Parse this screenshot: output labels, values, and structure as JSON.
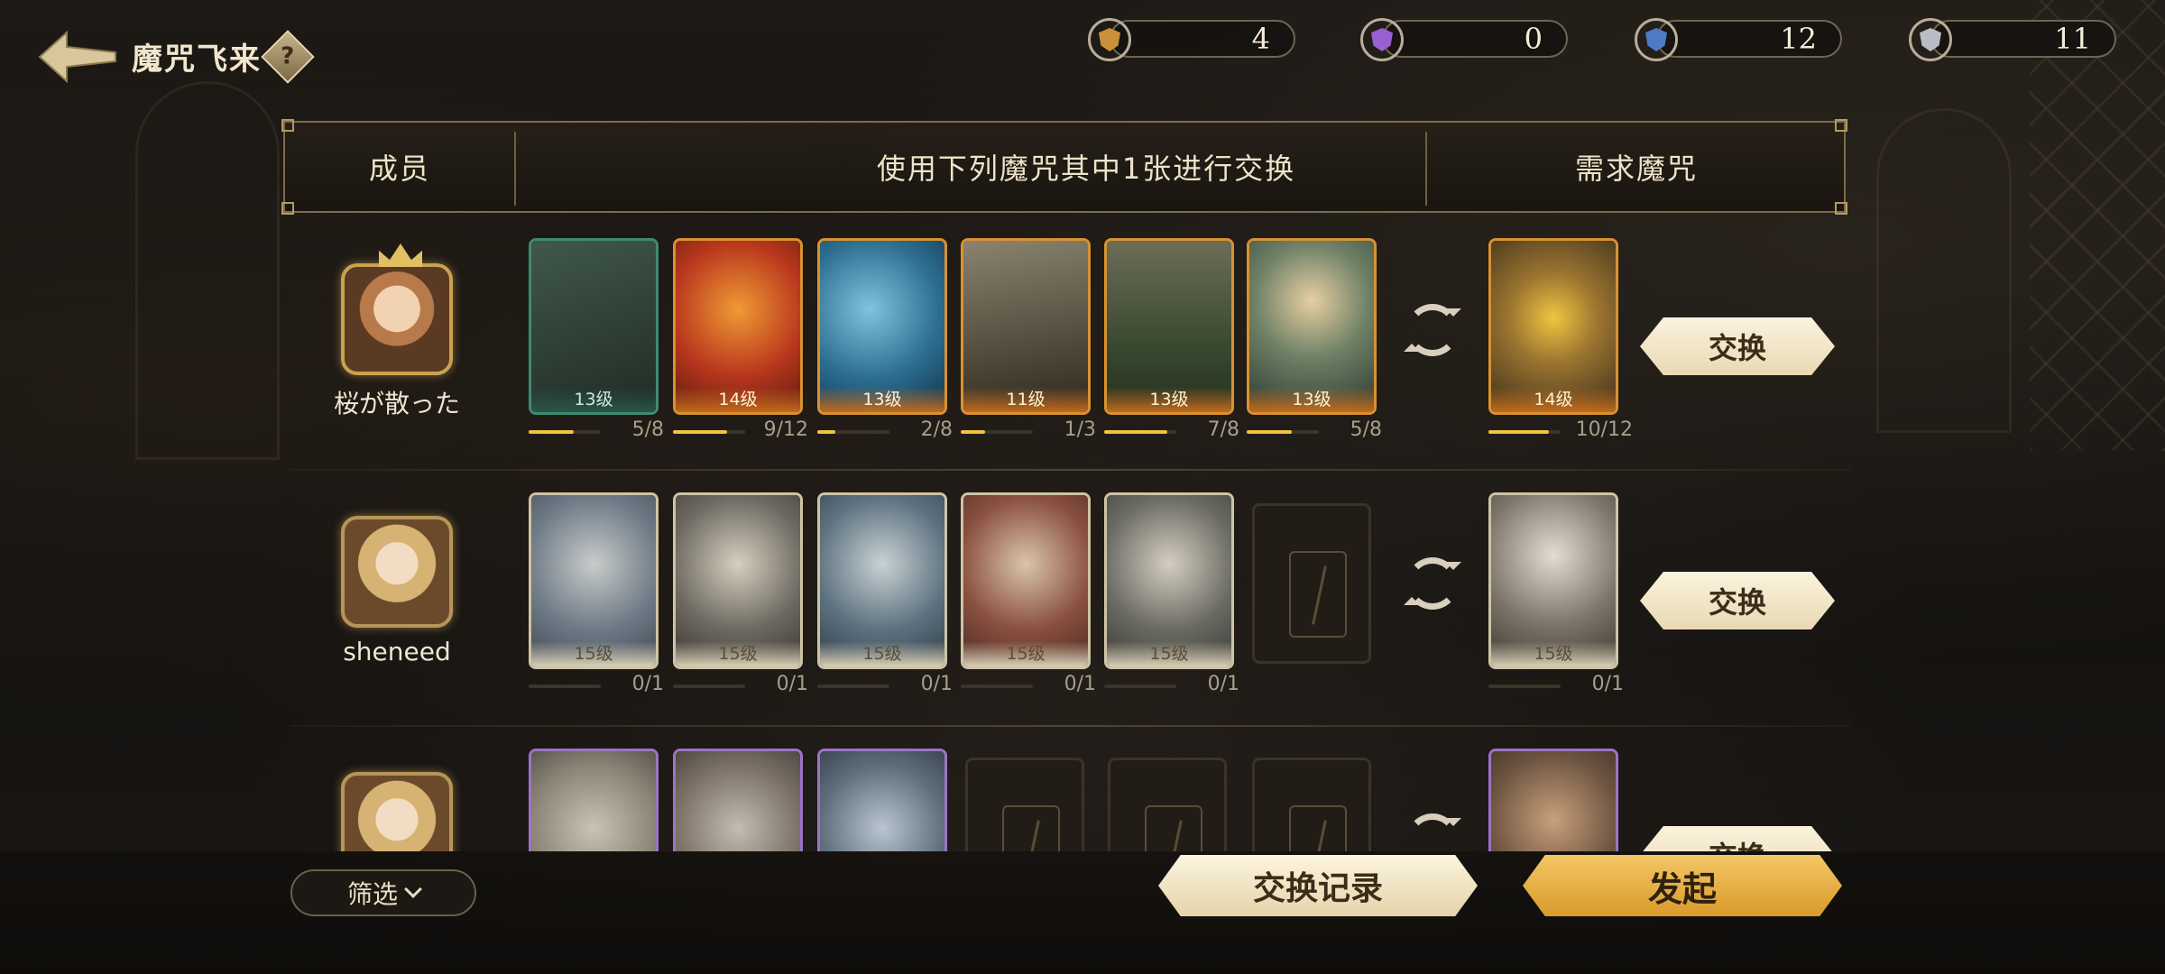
{
  "header": {
    "title": "魔咒飞来",
    "help_label": "?",
    "currencies": [
      {
        "name": "gold-badge",
        "color": "#c9923a",
        "value": "4"
      },
      {
        "name": "purple-badge",
        "color": "#9a5fd1",
        "value": "0"
      },
      {
        "name": "blue-badge",
        "color": "#4f79c7",
        "value": "12"
      },
      {
        "name": "silver-badge",
        "color": "#b8bcc4",
        "value": "11"
      }
    ]
  },
  "table": {
    "col_member": "成员",
    "col_offer": "使用下列魔咒其中1张进行交换",
    "col_need": "需求魔咒"
  },
  "rows": [
    {
      "member": "桜が散った",
      "offer": [
        {
          "rarity": "green",
          "level": "13级",
          "progress": "5/8",
          "fill": 0.625,
          "art": "#2c3b33"
        },
        {
          "rarity": "orange",
          "level": "14级",
          "progress": "9/12",
          "fill": 0.75,
          "art": "#b8371d"
        },
        {
          "rarity": "orange",
          "level": "13级",
          "progress": "2/8",
          "fill": 0.25,
          "art": "#2c6d8f"
        },
        {
          "rarity": "orange",
          "level": "11级",
          "progress": "1/3",
          "fill": 0.333,
          "art": "#5a5344"
        },
        {
          "rarity": "orange",
          "level": "13级",
          "progress": "7/8",
          "fill": 0.875,
          "art": "#4c5a3a"
        },
        {
          "rarity": "orange",
          "level": "13级",
          "progress": "5/8",
          "fill": 0.625,
          "art": "#5b6a55"
        }
      ],
      "need": {
        "rarity": "orange",
        "level": "14级",
        "progress": "10/12",
        "fill": 0.833,
        "art": "#7a5a2a"
      },
      "button": "交换"
    },
    {
      "member": "sheneed",
      "offer": [
        {
          "rarity": "parch",
          "level": "15级",
          "progress": "0/1",
          "fill": 0,
          "art": "#6e7a86"
        },
        {
          "rarity": "parch",
          "level": "15级",
          "progress": "0/1",
          "fill": 0,
          "art": "#6e6a62"
        },
        {
          "rarity": "parch",
          "level": "15级",
          "progress": "0/1",
          "fill": 0,
          "art": "#5d7280"
        },
        {
          "rarity": "parch",
          "level": "15级",
          "progress": "0/1",
          "fill": 0,
          "art": "#8a5040"
        },
        {
          "rarity": "parch",
          "level": "15级",
          "progress": "0/1",
          "fill": 0,
          "art": "#6b6b64"
        },
        {
          "rarity": "empty"
        }
      ],
      "need": {
        "rarity": "parch",
        "level": "15级",
        "progress": "0/1",
        "fill": 0,
        "art": "#7c7468"
      },
      "button": "交换"
    }
  ],
  "row3": {
    "offer_arts": [
      "#8b8577",
      "#7b7167",
      "#5f6e7c"
    ],
    "need_art": "#6a5240",
    "button": "交换"
  },
  "footer": {
    "filter": "筛选",
    "record": "交换记录",
    "launch": "发起"
  }
}
